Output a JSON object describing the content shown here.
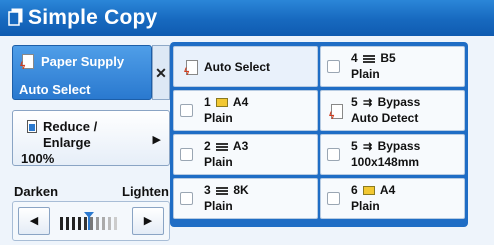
{
  "title": "Simple Copy",
  "paper_supply": {
    "label": "Paper Supply",
    "value": "Auto Select"
  },
  "reduce_enlarge": {
    "line1": "Reduce /",
    "line2": "Enlarge",
    "value": "100%"
  },
  "darkness": {
    "left_label": "Darken",
    "right_label": "Lighten",
    "level": 0.5
  },
  "options": [
    {
      "id": "auto-select",
      "line1": "Auto Select",
      "line2": "",
      "icon": "paper-flame-icon",
      "selected": true
    },
    {
      "id": "tray-4",
      "line1": "4 B5",
      "line2": "Plain",
      "icon": "tray-lines-icon",
      "selected": false
    },
    {
      "id": "tray-1",
      "line1": "1 A4",
      "line2": "Plain",
      "icon": "tray-paper-icon",
      "selected": false
    },
    {
      "id": "bypass-auto",
      "line1": "5 Bypass",
      "line2": "Auto Detect",
      "icon": "bypass-icon",
      "selected": false
    },
    {
      "id": "tray-2",
      "line1": "2 A3",
      "line2": "Plain",
      "icon": "tray-lines-icon",
      "selected": false
    },
    {
      "id": "bypass-100",
      "line1": "5 Bypass",
      "line2": "100x148mm",
      "icon": "bypass-icon",
      "selected": false
    },
    {
      "id": "tray-3",
      "line1": "3 8K",
      "line2": "Plain",
      "icon": "tray-lines-icon",
      "selected": false
    },
    {
      "id": "tray-6",
      "line1": "6 A4",
      "line2": "Plain",
      "icon": "tray-paper-icon",
      "selected": false
    }
  ],
  "colors": {
    "accent": "#1f6dc5",
    "title_bar": "#1769bf"
  }
}
